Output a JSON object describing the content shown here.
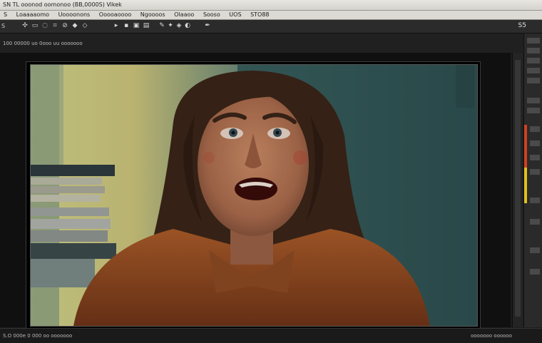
{
  "window": {
    "title": "SN TL ooonod oomonoo (BB,0000S) Vikek"
  },
  "menu": {
    "items": [
      "S",
      "Loaaaaomo",
      "Uoooonons",
      "Ooooaoooo",
      "Ngoooos",
      "Olaaoo",
      "Sooso",
      "UOS",
      "STO88"
    ]
  },
  "toolbar": {
    "left_label": "S",
    "zoom": "S5"
  },
  "document": {
    "tab_label": "100 00000 uo 0ooo   uu ooooooo"
  },
  "colors": {
    "accent_meter_top": "#d04020",
    "accent_meter_bottom": "#e0c020"
  },
  "status": {
    "left": "S.O 000e 0 000 oo ooooooo",
    "right": "ooooooo  oooooo"
  }
}
